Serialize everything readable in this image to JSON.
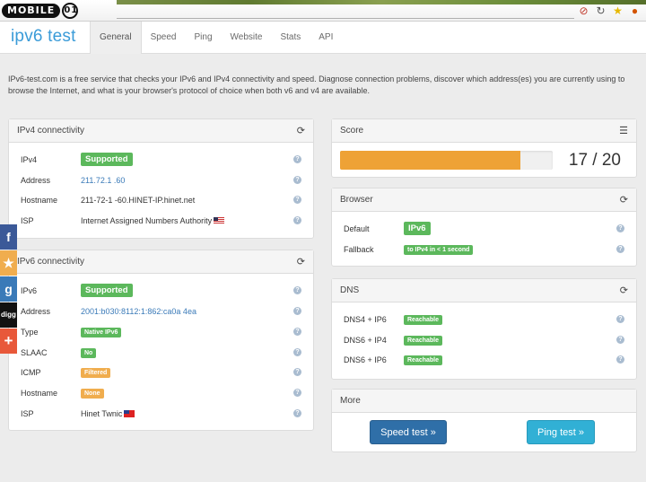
{
  "site_logo": {
    "text": "MOBILE",
    "badge": "01"
  },
  "brand": "ipv6 test",
  "tabs": [
    {
      "label": "General",
      "active": true
    },
    {
      "label": "Speed"
    },
    {
      "label": "Ping"
    },
    {
      "label": "Website"
    },
    {
      "label": "Stats"
    },
    {
      "label": "API"
    }
  ],
  "intro": "IPv6-test.com is a free service that checks your IPv6 and IPv4 connectivity and speed. Diagnose connection problems, discover which address(es) you are currently using to browse the Internet, and what is your browser's protocol of choice when both v6 and v4 are available.",
  "ipv4": {
    "title": "IPv4 connectivity",
    "rows": [
      {
        "label": "IPv4",
        "value": "Supported",
        "kind": "label-big",
        "color": "#5cb85c"
      },
      {
        "label": "Address",
        "value": "211.72.1 .60",
        "kind": "link"
      },
      {
        "label": "Hostname",
        "value": "211-72-1 -60.HINET-IP.hinet.net",
        "kind": "text"
      },
      {
        "label": "ISP",
        "value": "Internet Assigned Numbers Authority",
        "kind": "text",
        "flag": "us"
      }
    ]
  },
  "ipv6": {
    "title": "IPv6 connectivity",
    "rows": [
      {
        "label": "IPv6",
        "value": "Supported",
        "kind": "label-big",
        "color": "#5cb85c"
      },
      {
        "label": "Address",
        "value": "2001:b030:8112:1:862:ca0a 4ea",
        "kind": "link"
      },
      {
        "label": "Type",
        "value": "Native IPv6",
        "kind": "label-sm",
        "color": "#5cb85c"
      },
      {
        "label": "SLAAC",
        "value": "No",
        "kind": "label-sm",
        "color": "#5cb85c"
      },
      {
        "label": "ICMP",
        "value": "Filtered",
        "kind": "label-sm",
        "color": "#f0ad4e"
      },
      {
        "label": "Hostname",
        "value": "None",
        "kind": "label-sm",
        "color": "#f0ad4e"
      },
      {
        "label": "ISP",
        "value": "Hinet Twnic",
        "kind": "text",
        "flag": "tw"
      }
    ]
  },
  "score": {
    "title": "Score",
    "value": 17,
    "max": 20,
    "display": "17 / 20",
    "progress": 0.85,
    "bar_color": "#eea236"
  },
  "browser": {
    "title": "Browser",
    "rows": [
      {
        "label": "Default",
        "value": "IPv6",
        "kind": "label-big",
        "color": "#5cb85c"
      },
      {
        "label": "Fallback",
        "value": "to IPv4 in < 1 second",
        "kind": "label-sm",
        "color": "#5cb85c"
      }
    ]
  },
  "dns": {
    "title": "DNS",
    "rows": [
      {
        "label": "DNS4 + IP6",
        "value": "Reachable",
        "kind": "label-sm",
        "color": "#5cb85c"
      },
      {
        "label": "DNS6 + IP4",
        "value": "Reachable",
        "kind": "label-sm",
        "color": "#5cb85c"
      },
      {
        "label": "DNS6 + IP6",
        "value": "Reachable",
        "kind": "label-sm",
        "color": "#5cb85c"
      }
    ]
  },
  "more": {
    "title": "More",
    "speed_btn": "Speed test »",
    "ping_btn": "Ping test »"
  },
  "share": [
    {
      "icon": "facebook-icon",
      "glyph": "f",
      "color": "#3b5998"
    },
    {
      "icon": "star-icon",
      "glyph": "★",
      "color": "#f0ad4e"
    },
    {
      "icon": "google-icon",
      "glyph": "g",
      "color": "#3a7ab8"
    },
    {
      "icon": "digg-icon",
      "glyph": "digg",
      "color": "#111111"
    },
    {
      "icon": "plus-icon",
      "glyph": "+",
      "color": "#e8583a"
    }
  ]
}
